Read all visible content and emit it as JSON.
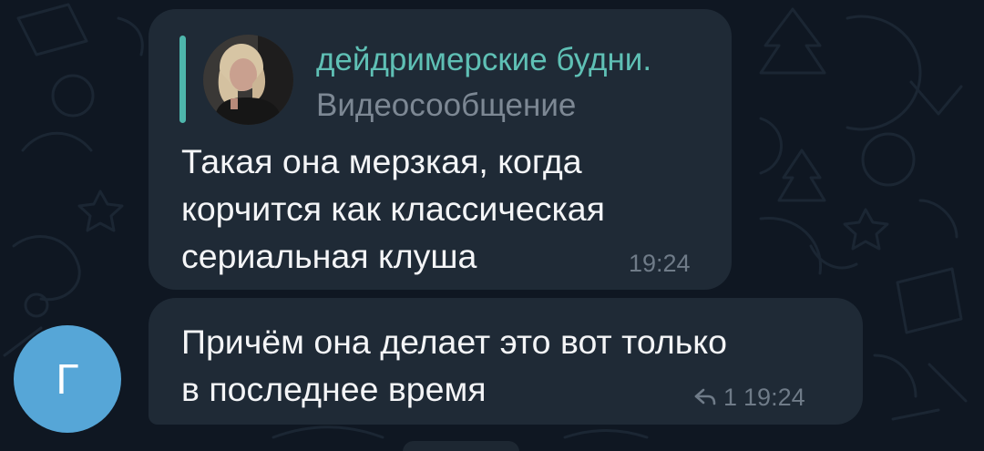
{
  "theme": {
    "background": "#0f1722",
    "bubble": "#1f2a36",
    "accent": "#5fc0b5",
    "avatar": "#56a6d7",
    "muted": "#6f7b88"
  },
  "messages": [
    {
      "reply_preview": {
        "author": "дейдримерские будни.",
        "type": "Видеосообщение",
        "thumbnail_icon": "video-circle-thumbnail"
      },
      "text": "Такая она мерзкая, когда\nкорчится как классическая\nсериальная клуша",
      "time": "19:24"
    },
    {
      "text": "Причём она делает это вот только\nв последнее время",
      "reply_count": "1",
      "reply_icon": "reply-arrow-icon",
      "time": "19:24"
    }
  ],
  "sender": {
    "avatar_letter": "Г"
  }
}
